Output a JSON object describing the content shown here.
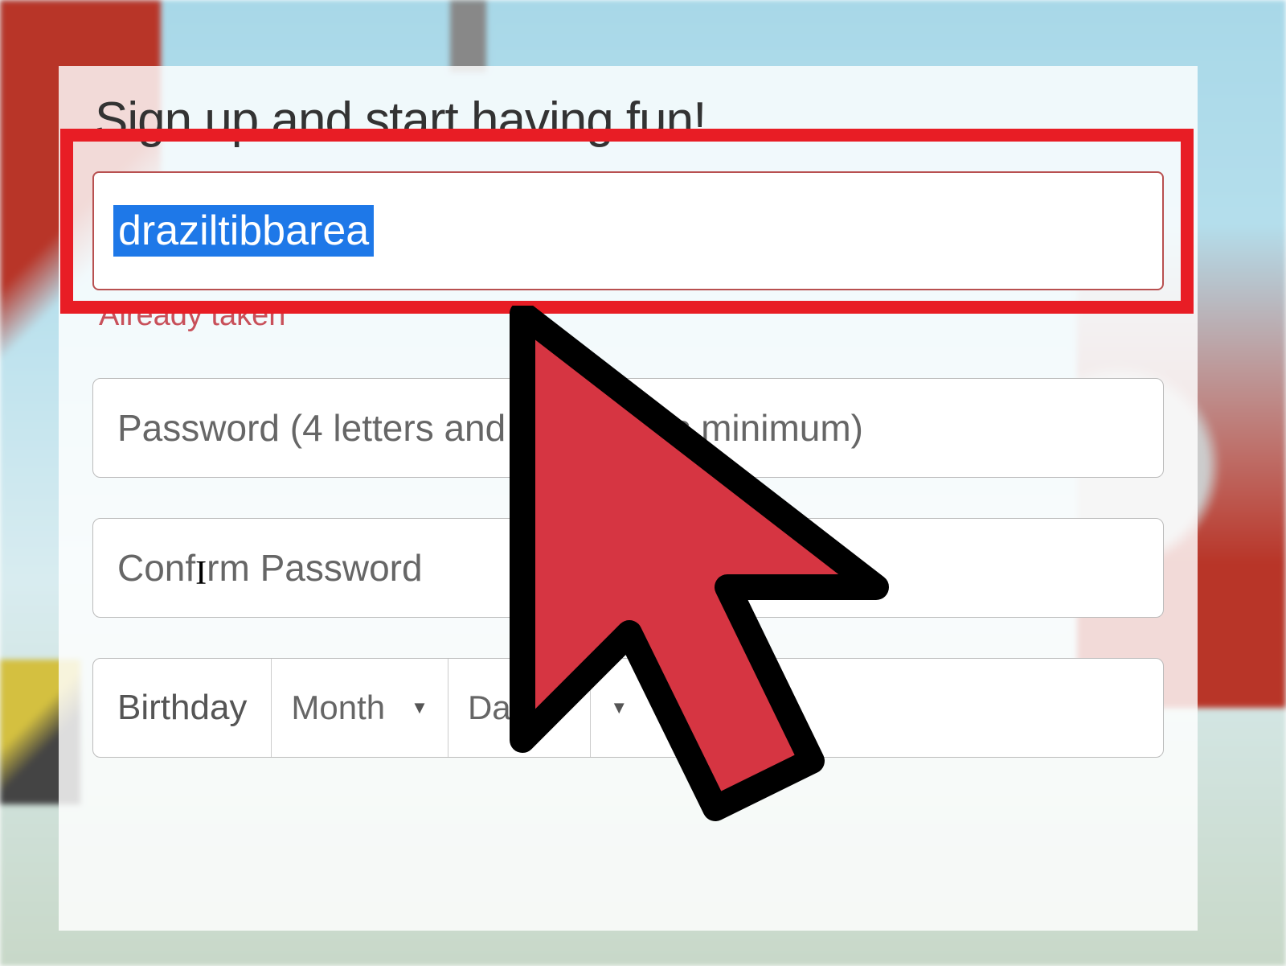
{
  "form": {
    "title": "Sign up and start having fun!",
    "username": {
      "value": "draziltibbarea",
      "error": "Already taken"
    },
    "password": {
      "placeholder": "Password (4 letters and 2 numbers minimum)"
    },
    "confirm": {
      "placeholder_start": "Conf",
      "placeholder_end": "rm Password"
    },
    "birthday": {
      "label": "Birthday",
      "month": "Month",
      "day": "Day"
    }
  },
  "colors": {
    "highlight": "#e81d25",
    "selection": "#1e78e8",
    "error": "#c8505a",
    "cursor_fill": "#d63542"
  }
}
